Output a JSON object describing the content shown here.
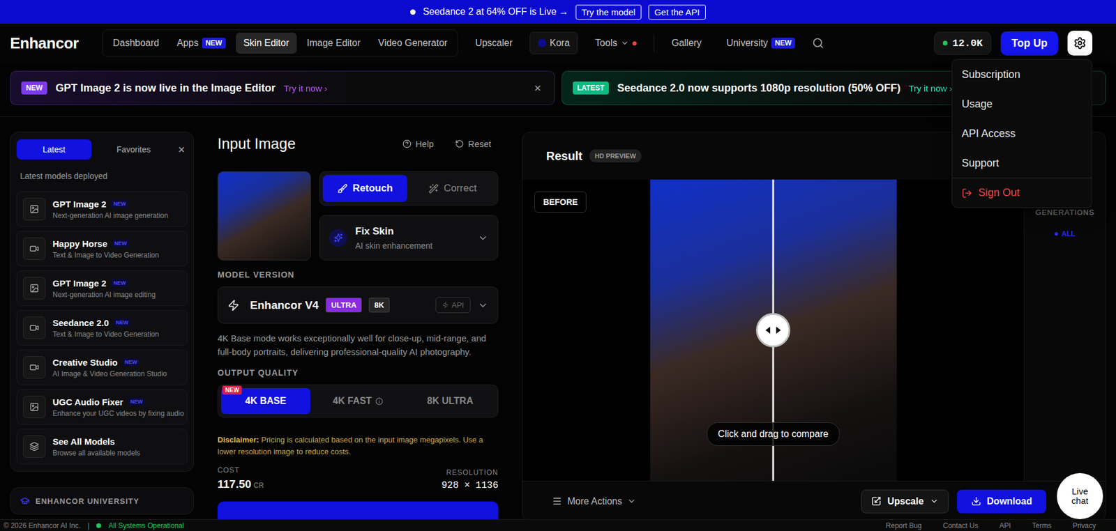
{
  "promo": {
    "text": "Seedance 2 at 64% OFF is Live →",
    "buttons": [
      "Try the model",
      "Get the API"
    ]
  },
  "nav": {
    "logo": "Enhancor",
    "primary": [
      {
        "label": "Dashboard",
        "selected": false
      },
      {
        "label": "Apps",
        "selected": false,
        "badge": "NEW"
      },
      {
        "label": "Skin Editor",
        "selected": true
      },
      {
        "label": "Image Editor",
        "selected": false
      },
      {
        "label": "Video Generator",
        "selected": false
      }
    ],
    "secondary": [
      {
        "label": "Upscaler",
        "kind": "link",
        "selected": false,
        "alert": false
      },
      {
        "label": "Kora",
        "kind": "pill",
        "selected": false,
        "alert": false
      },
      {
        "label": "Tools",
        "kind": "menu",
        "selected": false,
        "alert": true
      }
    ],
    "tertiary": [
      {
        "label": "Gallery",
        "selected": false
      },
      {
        "label": "University",
        "selected": false,
        "badge": "NEW"
      }
    ],
    "credits": "12.0K",
    "top_up": "Top Up",
    "settings_open": true
  },
  "settings_menu": [
    {
      "label": "Subscription",
      "kind": "item"
    },
    {
      "label": "Usage",
      "kind": "item"
    },
    {
      "label": "API Access",
      "kind": "item"
    },
    {
      "label": "Support",
      "kind": "item"
    },
    {
      "label": "Sign Out",
      "kind": "danger"
    }
  ],
  "banners": [
    {
      "badge": "NEW",
      "text": "GPT Image 2 is now live in the Image Editor",
      "link": "Try it now ›",
      "color": "#7c3aed",
      "close": "×"
    },
    {
      "badge": "LATEST",
      "text": "Seedance 2.0 now supports 1080p resolution (50% OFF)",
      "link": "Try it now ›",
      "color": "#10b981"
    }
  ],
  "sidebar": {
    "tabs": [
      {
        "label": "Latest",
        "selected": true
      },
      {
        "label": "Favorites",
        "selected": false
      }
    ],
    "close": "×",
    "heading": "Latest models deployed",
    "models": [
      {
        "title": "GPT Image 2",
        "subtitle": "Next-generation AI image generation",
        "badge": "NEW",
        "kind": "image"
      },
      {
        "title": "Happy Horse",
        "subtitle": "Text & Image to Video Generation",
        "badge": "NEW",
        "kind": "video"
      },
      {
        "title": "GPT Image 2",
        "subtitle": "Next-generation AI image editing",
        "badge": "NEW",
        "kind": "image"
      },
      {
        "title": "Seedance 2.0",
        "subtitle": "Text & Image to Video Generation",
        "badge": "NEW",
        "kind": "video"
      },
      {
        "title": "Creative Studio",
        "subtitle": "AI Image & Video Generation Studio",
        "badge": "NEW",
        "kind": "video"
      },
      {
        "title": "UGC Audio Fixer",
        "subtitle": "Enhance your UGC videos by fixing audio",
        "badge": "NEW",
        "kind": "image"
      },
      {
        "title": "See All Models",
        "subtitle": "Browse all available models",
        "kind": "library"
      }
    ],
    "university": "ENHANCOR UNIVERSITY"
  },
  "input": {
    "title": "Input Image",
    "help": "Help",
    "reset": "Reset",
    "modes": [
      {
        "label": "Retouch",
        "selected": true
      },
      {
        "label": "Correct",
        "selected": false
      }
    ],
    "tool": {
      "title": "Fix Skin",
      "subtitle": "AI skin enhancement"
    },
    "model_label": "MODEL VERSION",
    "model": {
      "name": "Enhancor V4",
      "badges": [
        {
          "label": "ULTRA",
          "color": "#8a2be2"
        },
        {
          "label": "8K",
          "color": "#262626"
        }
      ],
      "api": "API"
    },
    "description": "4K Base mode works exceptionally well for close-up, mid-range, and full-body portraits, delivering professional-quality AI photography.",
    "quality_label": "OUTPUT QUALITY",
    "qualities": [
      {
        "label": "4K BASE",
        "selected": true,
        "badge": "NEW",
        "info": false
      },
      {
        "label": "4K FAST",
        "selected": false,
        "info": true
      },
      {
        "label": "8K ULTRA",
        "selected": false,
        "info": false
      }
    ],
    "disclaimer": {
      "label": "Disclaimer:",
      "text": "Pricing is calculated based on the input image megapixels. Use a lower resolution image to reduce costs."
    },
    "cost": {
      "label": "COST",
      "value": "117.50",
      "unit": "CR"
    },
    "resolution": {
      "label": "RESOLUTION",
      "value": "928 × 1136"
    }
  },
  "result": {
    "title": "Result",
    "badge": "HD PREVIEW",
    "before": "BEFORE",
    "hint": "Click and drag to compare",
    "level": 0.5,
    "generations": {
      "label": "GENERATIONS",
      "filter": "ALL"
    },
    "more_actions": "More Actions",
    "upscale": "Upscale",
    "download": "Download"
  },
  "footer": {
    "copyright": "© 2026 Enhancor AI Inc.",
    "separator": "|",
    "status": "All Systems Operational",
    "links": [
      "Report Bug",
      "Contact Us",
      "API",
      "Terms",
      "Privacy"
    ]
  },
  "live_chat": "Live chat"
}
